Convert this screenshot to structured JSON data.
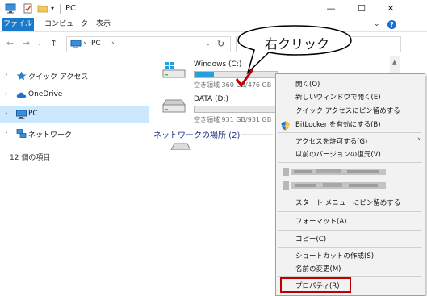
{
  "titlebar": {
    "title": "PC",
    "minimize": "—",
    "maximize": "☐",
    "close": "✕",
    "qa_dropdown": "▾"
  },
  "ribbon": {
    "tabs": [
      "ファイル",
      "コンピューター",
      "表示"
    ],
    "collapse": "⌄",
    "help": "?"
  },
  "navbar": {
    "back": "←",
    "forward": "→",
    "history": "⌄",
    "up": "↑",
    "address_sep": "›",
    "address_text": "PC",
    "address_dropdown": "⌄",
    "refresh": "↻"
  },
  "navpane": {
    "items": [
      {
        "label": "クイック アクセス",
        "chevron": "›"
      },
      {
        "label": "OneDrive",
        "chevron": "›"
      },
      {
        "label": "PC",
        "chevron": "›"
      },
      {
        "label": "ネットワーク",
        "chevron": "›"
      }
    ],
    "item_count": "12 個の項目"
  },
  "content": {
    "drives": [
      {
        "name": "Windows (C:)",
        "free_text": "空き領域 360 GB/476 GB",
        "used_fraction": 0.24
      },
      {
        "name": "DATA (D:)",
        "free_text": "空き領域 931 GB/931 GB",
        "used_fraction": 0.0
      }
    ],
    "network_header": "ネットワークの場所 (2)"
  },
  "context_menu": {
    "items": [
      "開く(O)",
      "新しいウィンドウで開く(E)",
      "クイック アクセスにピン留めする",
      "BitLocker を有効にする(B)",
      "アクセスを許可する(G)",
      "以前のバージョンの復元(V)",
      "スタート メニューにピン留めする",
      "フォーマット(A)...",
      "コピー(C)",
      "ショートカットの作成(S)",
      "名前の変更(M)",
      "プロパティ(R)"
    ],
    "submenu_arrow": "›"
  },
  "callout": {
    "text": "右クリック"
  },
  "colors": {
    "accent": "#1979ca",
    "selection": "#cce8ff",
    "drive_bar": "#26a0da",
    "highlight_box": "#c00000",
    "checkmark": "#c00000"
  }
}
